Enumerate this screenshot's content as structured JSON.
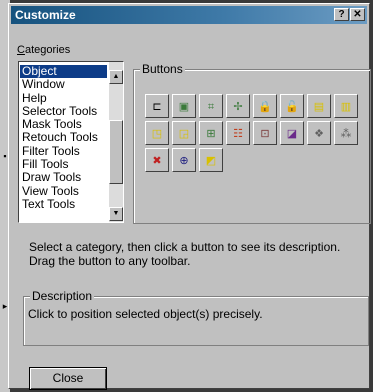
{
  "window": {
    "title": "Customize",
    "help_label": "?",
    "close_label": "✕"
  },
  "categories": {
    "label_underlined": "C",
    "label_rest": "ategories",
    "items": [
      "Object",
      "Window",
      "Help",
      "Selector Tools",
      "Mask Tools",
      "Retouch Tools",
      "Filter Tools",
      "Fill Tools",
      "Draw Tools",
      "View Tools",
      "Text Tools"
    ],
    "selected_index": 0,
    "scroll_up": "▲",
    "scroll_down": "▼"
  },
  "buttons_group": {
    "label": "Buttons",
    "icons": [
      {
        "name": "align-left-icon",
        "glyph": "⊏",
        "color": "#000000"
      },
      {
        "name": "align-center-icon",
        "glyph": "▣",
        "color": "#3a7a3a"
      },
      {
        "name": "align-corners-icon",
        "glyph": "⌗",
        "color": "#3a7a3a"
      },
      {
        "name": "align-middle-icon",
        "glyph": "✢",
        "color": "#3a7a3a"
      },
      {
        "name": "lock-icon",
        "glyph": "🔒",
        "color": "#000000"
      },
      {
        "name": "unlock-icon",
        "glyph": "🔓",
        "color": "#000000"
      },
      {
        "name": "bring-forward-icon",
        "glyph": "▤",
        "color": "#d8c000"
      },
      {
        "name": "send-backward-icon",
        "glyph": "▥",
        "color": "#d8c000"
      },
      {
        "name": "group-icon",
        "glyph": "◳",
        "color": "#d8c000"
      },
      {
        "name": "ungroup-icon",
        "glyph": "◲",
        "color": "#d8c000"
      },
      {
        "name": "distribute-icon",
        "glyph": "⊞",
        "color": "#3a7a3a"
      },
      {
        "name": "combine-icon",
        "glyph": "☷",
        "color": "#c04020"
      },
      {
        "name": "position-icon",
        "glyph": "⊡",
        "color": "#7a3a3a"
      },
      {
        "name": "crop-icon",
        "glyph": "◪",
        "color": "#6a2a8a"
      },
      {
        "name": "feather-icon",
        "glyph": "❖",
        "color": "#606060"
      },
      {
        "name": "merge-icon",
        "glyph": "⁂",
        "color": "#606060"
      },
      {
        "name": "delete-object-icon",
        "glyph": "✖",
        "color": "#c02020"
      },
      {
        "name": "object-properties-icon",
        "glyph": "⊕",
        "color": "#202080"
      },
      {
        "name": "transparency-icon",
        "glyph": "◩",
        "color": "#d8c000"
      }
    ]
  },
  "info_text": "Select a category, then click a button to see its description. Drag the button to any toolbar.",
  "description": {
    "label": "Description",
    "text": "Click to position selected object(s) precisely."
  },
  "close_button": "Close"
}
